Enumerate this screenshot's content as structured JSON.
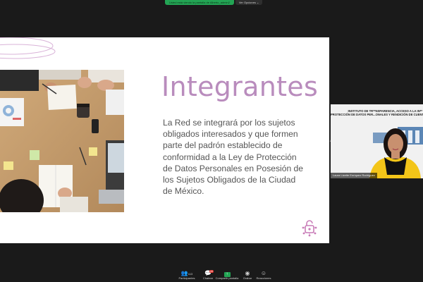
{
  "share_bar": {
    "status": "Usted está viendo la pantalla de Alberto_admin2",
    "view_options": "Ver Opciones ⌄"
  },
  "slide": {
    "title": "Integrantes",
    "body": "La Red se integrará por los sujetos obligados interesados y que formen parte del padrón establecido de conformidad a la Ley de Protección de Datos Personales en Posesión de los Sujetos Obligados de la Ciudad de México.",
    "accent_color": "#b98cbd",
    "brand_icon": "lock-network-icon"
  },
  "video_tile": {
    "banner_line1": "INSTITUTO DE TR**NSPARENCIA, ACCESO A LA IN**",
    "banner_line2": "PROTECCIÓN DE DATOS PER...ONALES Y RENDICIÓN DE CUENTA",
    "participant_name": "Laura Lizette Enríquez Rodríguez"
  },
  "toolbar": {
    "items": [
      {
        "icon": "participants-icon",
        "label": "Participantes",
        "count": "113"
      },
      {
        "icon": "chat-icon",
        "label": "Chatear",
        "badge": "44"
      },
      {
        "icon": "share-screen-icon",
        "label": "Compartir pantalla"
      },
      {
        "icon": "record-icon",
        "label": "Grabar"
      },
      {
        "icon": "reactions-icon",
        "label": "Reacciones"
      }
    ]
  }
}
